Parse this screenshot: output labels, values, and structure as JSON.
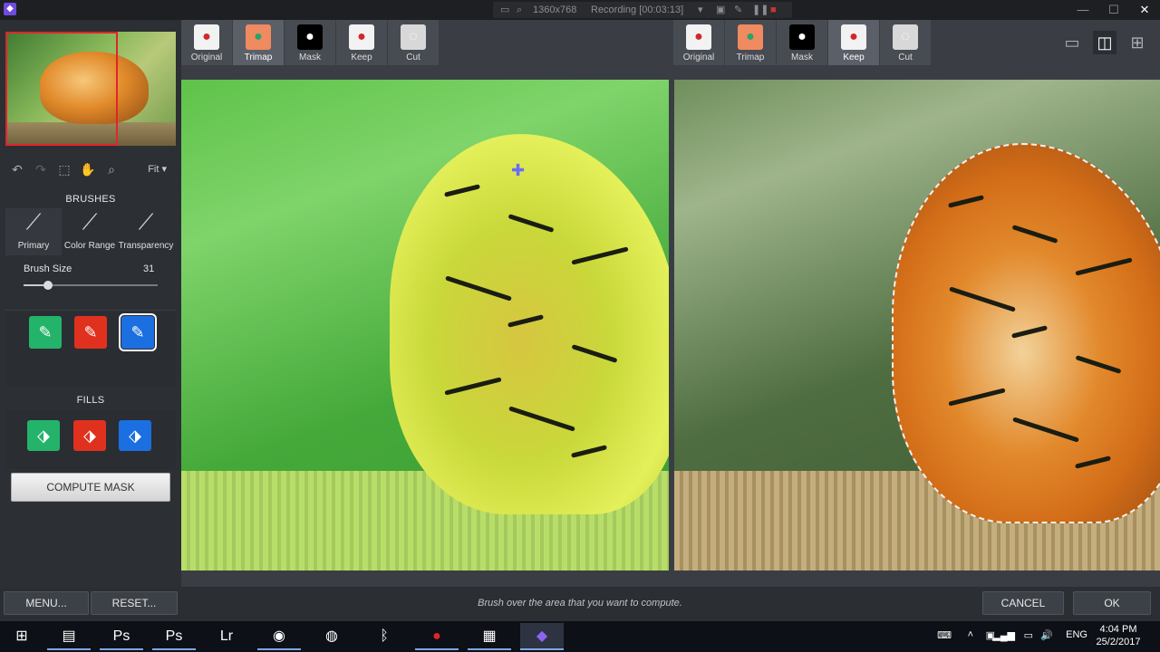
{
  "titlebar": {
    "app_icon": "app-logo-icon",
    "resolution": "1360x768",
    "recording": "Recording [00:03:13]",
    "controls": {
      "minimize": "—",
      "maximize": "☐",
      "close": "✕"
    }
  },
  "thumbnail": {
    "alt": "tiger"
  },
  "toolbar": {
    "undo": "↶",
    "redo": "↷",
    "select": "⬚",
    "pan": "✋",
    "zoom": "🔍",
    "fit_label": "Fit"
  },
  "brushes": {
    "title": "BRUSHES",
    "items": [
      {
        "label": "Primary",
        "icon": "primary-brush-icon"
      },
      {
        "label": "Color Range",
        "icon": "color-range-brush-icon"
      },
      {
        "label": "Transparency",
        "icon": "transparency-brush-icon"
      }
    ],
    "size_label": "Brush Size",
    "size_value": "31",
    "size_fraction": 0.18
  },
  "modes": [
    {
      "name": "keep",
      "color": "#24b36b",
      "glyph": "✎"
    },
    {
      "name": "cut",
      "color": "#e0311f",
      "glyph": "✎"
    },
    {
      "name": "compute",
      "color": "#1c6fe0",
      "glyph": "✎"
    }
  ],
  "fills": {
    "title": "FILLS",
    "items": [
      {
        "name": "keep-fill",
        "color": "#24b36b",
        "glyph": "⬗"
      },
      {
        "name": "cut-fill",
        "color": "#e0311f",
        "glyph": "⬗"
      },
      {
        "name": "compute-fill",
        "color": "#1c6fe0",
        "glyph": "⬗"
      }
    ]
  },
  "compute_mask": "COMPUTE MASK",
  "left_tabs": [
    {
      "label": "Original",
      "active": false
    },
    {
      "label": "Trimap",
      "active": true
    },
    {
      "label": "Mask",
      "active": false
    },
    {
      "label": "Keep",
      "active": false
    },
    {
      "label": "Cut",
      "active": false
    }
  ],
  "right_tabs": [
    {
      "label": "Original",
      "active": false
    },
    {
      "label": "Trimap",
      "active": false
    },
    {
      "label": "Mask",
      "active": false
    },
    {
      "label": "Keep",
      "active": true
    },
    {
      "label": "Cut",
      "active": false
    }
  ],
  "layout_buttons": [
    "single-view",
    "split-view",
    "quad-view"
  ],
  "bottom": {
    "menu": "MENU...",
    "reset": "RESET...",
    "hint": "Brush over the area that you want to compute.",
    "cancel": "CANCEL",
    "ok": "OK"
  },
  "taskbar": {
    "apps": [
      "windows-start-icon",
      "file-explorer-icon",
      "photoshop-icon",
      "photoshop-icon",
      "lightroom-icon",
      "chrome-icon",
      "internet-download-icon",
      "bluetooth-icon",
      "record-icon",
      "video-icon",
      "app-icon"
    ],
    "language": "ENG",
    "time": "4:04 PM",
    "date": "25/2/2017"
  }
}
